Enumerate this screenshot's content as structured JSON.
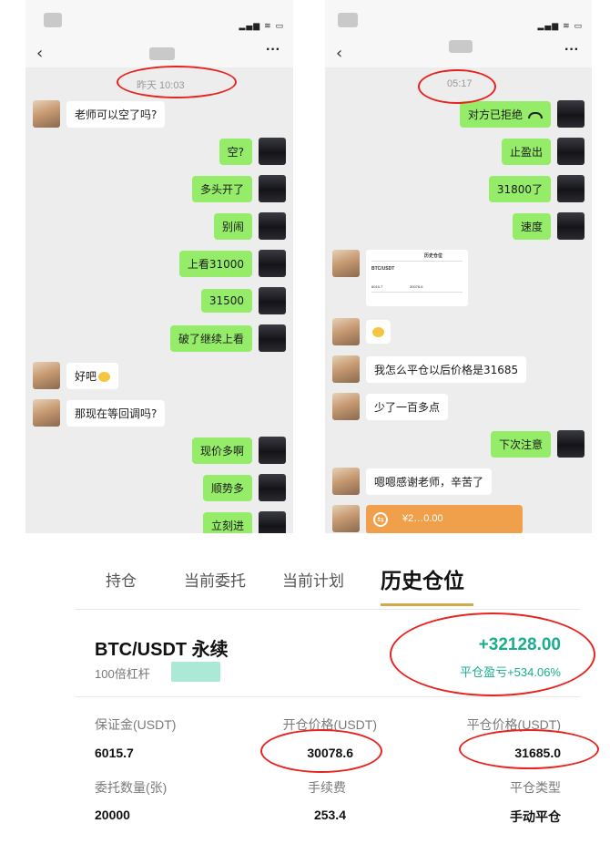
{
  "left_chat": {
    "time_label": "昨天 10:03",
    "more": "···",
    "back": "‹",
    "messages": [
      {
        "side": "left",
        "text": "老师可以空了吗?"
      },
      {
        "side": "right",
        "text": "空?"
      },
      {
        "side": "right",
        "text": "多头开了"
      },
      {
        "side": "right",
        "text": "别闹"
      },
      {
        "side": "right",
        "text": "上看31000"
      },
      {
        "side": "right",
        "text": "31500"
      },
      {
        "side": "right",
        "text": "破了继续上看"
      },
      {
        "side": "left",
        "text": "好吧"
      },
      {
        "side": "left",
        "text": "那现在等回调吗?"
      },
      {
        "side": "right",
        "text": "现价多啊"
      },
      {
        "side": "right",
        "text": "顺势多"
      },
      {
        "side": "right",
        "text": "立刻进"
      }
    ]
  },
  "right_chat": {
    "time_label": "05:17",
    "more": "···",
    "back": "‹",
    "messages": [
      {
        "side": "right",
        "text": "对方已拒绝"
      },
      {
        "side": "right",
        "text": "止盈出"
      },
      {
        "side": "right",
        "text": "31800了"
      },
      {
        "side": "right",
        "text": "速度"
      },
      {
        "side": "left",
        "text": "我怎么平仓以后价格是31685"
      },
      {
        "side": "left",
        "text": "少了一百多点"
      },
      {
        "side": "right",
        "text": "下次注意"
      },
      {
        "side": "left",
        "text": "嗯嗯感谢老师，辛苦了"
      }
    ],
    "screenshot_card": {
      "tab": "历史仓位",
      "pair": "BTC/USDT",
      "v1": "6015.7",
      "v2": "30078.6"
    },
    "transfer": {
      "amount": "¥2…0.00",
      "icon": "⇆"
    }
  },
  "sys_icons": "▂▄▆ ≋ ▭",
  "trading": {
    "tabs": [
      "持仓",
      "当前委托",
      "当前计划",
      "历史仓位"
    ],
    "active_tab": "历史仓位",
    "pair": "BTC/USDT 永续",
    "leverage": "100倍杠杆",
    "pnl": "+32128.00",
    "pnl_rate": "平仓盈亏+534.06%",
    "margin_label": "保证金(USDT)",
    "margin_value": "6015.7",
    "open_price_label": "开仓价格(USDT)",
    "open_price_value": "30078.6",
    "close_price_label": "平仓价格(USDT)",
    "close_price_value": "31685.0",
    "qty_label": "委托数量(张)",
    "qty_value": "20000",
    "fee_label": "手续费",
    "fee_value": "253.4",
    "close_type_label": "平仓类型",
    "close_type_value": "手动平仓",
    "colors": {
      "profit": "#1aae8f",
      "tab_underline": "#d4a94b",
      "annotation": "#e8231f"
    }
  }
}
